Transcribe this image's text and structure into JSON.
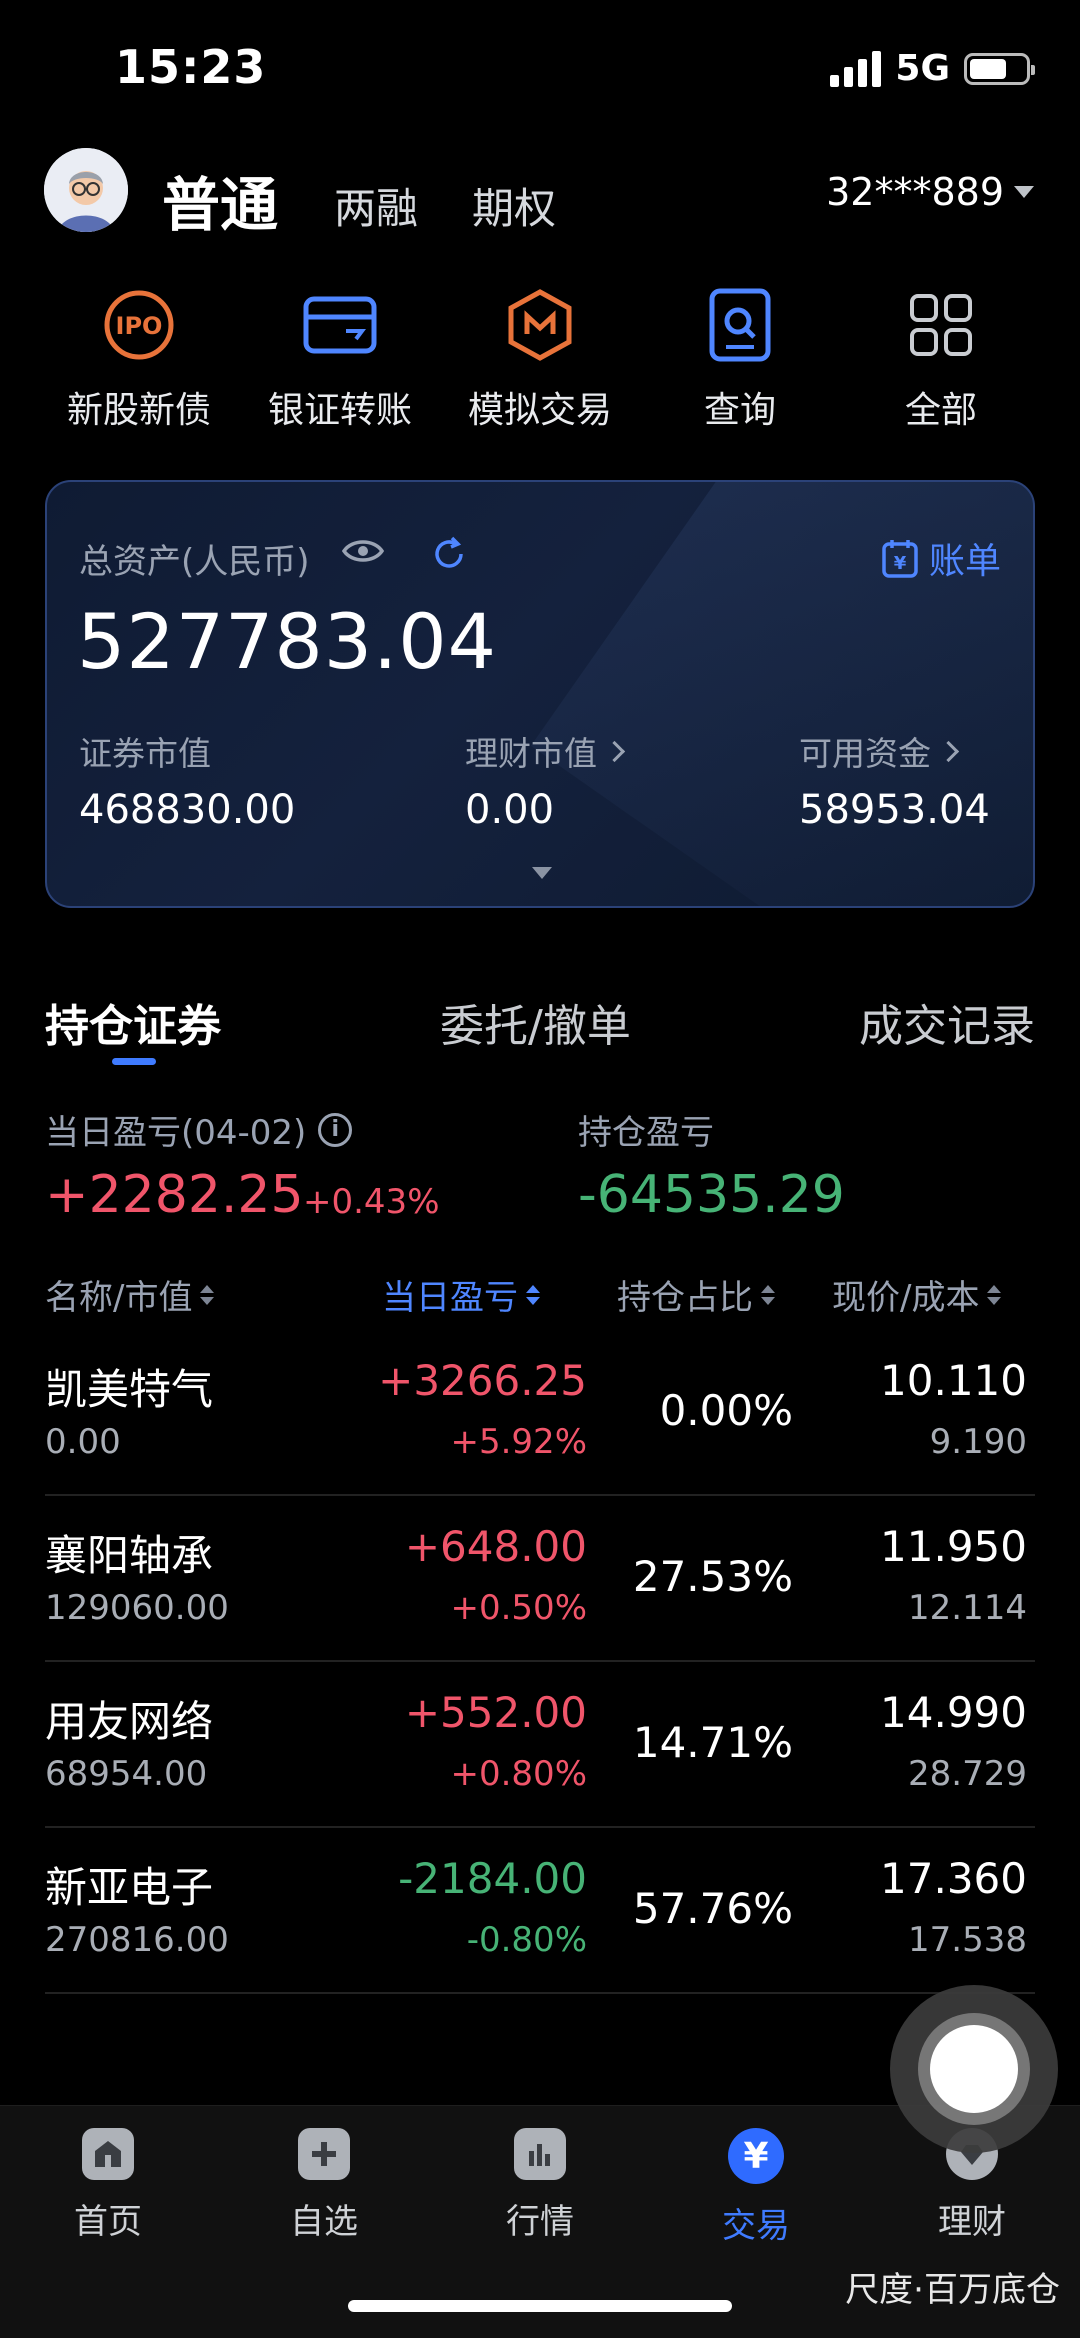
{
  "status": {
    "time": "15:23",
    "network": "5G"
  },
  "header": {
    "tab_active": "普通",
    "tab_2": "两融",
    "tab_3": "期权",
    "account": "32***889"
  },
  "shortcuts": [
    {
      "label": "新股新债",
      "icon": "ipo-icon"
    },
    {
      "label": "银证转账",
      "icon": "card-transfer-icon"
    },
    {
      "label": "模拟交易",
      "icon": "simulate-icon"
    },
    {
      "label": "查询",
      "icon": "query-icon"
    },
    {
      "label": "全部",
      "icon": "grid-icon"
    }
  ],
  "assets": {
    "label": "总资产(人民币)",
    "total": "527783.04",
    "bill": "账单",
    "securities_label": "证券市值",
    "securities_value": "468830.00",
    "wealth_label": "理财市值",
    "wealth_value": "0.00",
    "cash_label": "可用资金",
    "cash_value": "58953.04"
  },
  "tabs": {
    "t1": "持仓证券",
    "t2": "委托/撤单",
    "t3": "成交记录"
  },
  "pnl": {
    "daily_label": "当日盈亏(04-02)",
    "daily_value": "+2282.25",
    "daily_pct": "+0.43%",
    "hold_label": "持仓盈亏",
    "hold_value": "-64535.29"
  },
  "list_header": {
    "name": "名称/市值",
    "daily": "当日盈亏",
    "ratio": "持仓占比",
    "price": "现价/成本"
  },
  "rows": [
    {
      "name": "凯美特气",
      "mv": "0.00",
      "pnl": "+3266.25",
      "pct": "+5.92%",
      "ratio": "0.00%",
      "price": "10.110",
      "cost": "9.190"
    },
    {
      "name": "襄阳轴承",
      "mv": "129060.00",
      "pnl": "+648.00",
      "pct": "+0.50%",
      "ratio": "27.53%",
      "price": "11.950",
      "cost": "12.114"
    },
    {
      "name": "用友网络",
      "mv": "68954.00",
      "pnl": "+552.00",
      "pct": "+0.80%",
      "ratio": "14.71%",
      "price": "14.990",
      "cost": "28.729"
    },
    {
      "name": "新亚电子",
      "mv": "270816.00",
      "pnl": "-2184.00",
      "pct": "-0.80%",
      "ratio": "57.76%",
      "price": "17.360",
      "cost": "17.538"
    }
  ],
  "nav": [
    {
      "label": "首页"
    },
    {
      "label": "自选"
    },
    {
      "label": "行情"
    },
    {
      "label": "交易",
      "glyph": "¥"
    },
    {
      "label": "理财"
    }
  ],
  "watermark": "尺度·百万底仓",
  "colors": {
    "up": "#f0556a",
    "down": "#47b376",
    "accent": "#3f7bff"
  }
}
